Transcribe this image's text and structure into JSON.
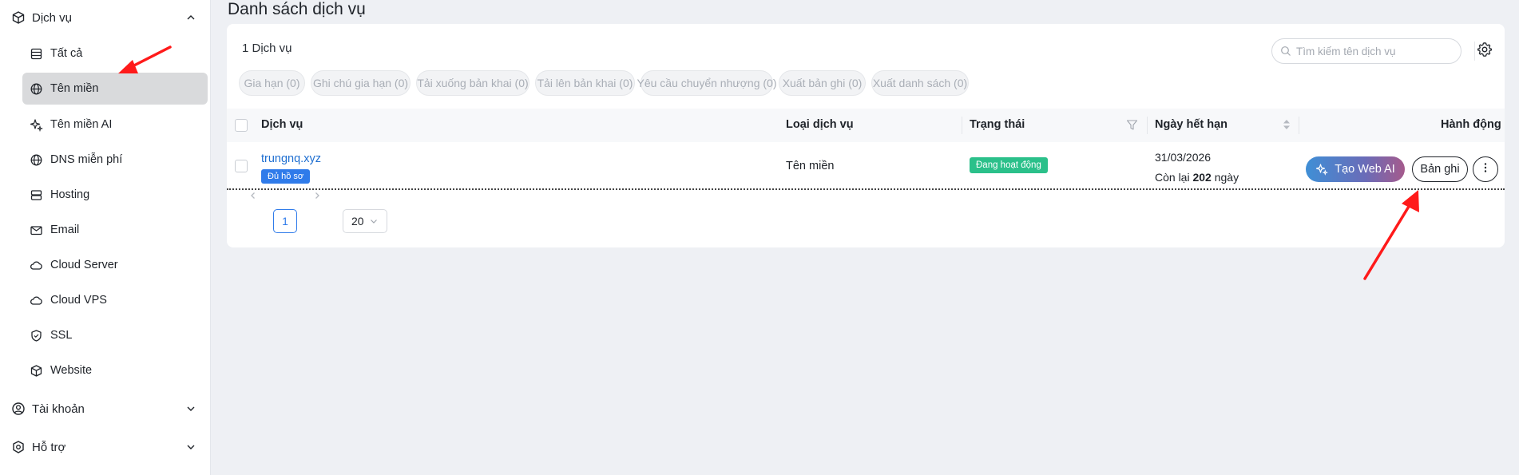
{
  "sidebar": {
    "services_label": "Dịch vụ",
    "items": [
      {
        "label": "Tất cả",
        "icon": "list-icon"
      },
      {
        "label": "Tên miền",
        "icon": "globe-icon"
      },
      {
        "label": "Tên miền AI",
        "icon": "sparkle-icon"
      },
      {
        "label": "DNS miễn phí",
        "icon": "globe-icon"
      },
      {
        "label": "Hosting",
        "icon": "server-icon"
      },
      {
        "label": "Email",
        "icon": "mail-icon"
      },
      {
        "label": "Cloud Server",
        "icon": "cloud-icon"
      },
      {
        "label": "Cloud VPS",
        "icon": "cloud-icon"
      },
      {
        "label": "SSL",
        "icon": "shield-icon"
      },
      {
        "label": "Website",
        "icon": "cube-icon"
      }
    ],
    "account_label": "Tài khoản",
    "support_label": "Hỗ trợ"
  },
  "page": {
    "title": "Danh sách dịch vụ",
    "count": "1 Dịch vụ",
    "search_placeholder": "Tìm kiếm tên dịch vụ"
  },
  "bulk_actions": [
    "Gia hạn (0)",
    "Ghi chú gia hạn (0)",
    "Tải xuống bản khai (0)",
    "Tải lên bản khai (0)",
    "Yêu cầu chuyển nhượng (0)",
    "Xuất bản ghi (0)",
    "Xuất danh sách (0)"
  ],
  "table": {
    "columns": [
      "Dịch vụ",
      "Loại dịch vụ",
      "Trạng thái",
      "Ngày hết hạn",
      "Hành động"
    ],
    "rows": [
      {
        "service": "trungnq.xyz",
        "badge": "Đủ hồ sơ",
        "type": "Tên miền",
        "status": "Đang hoạt động",
        "expiry_date": "31/03/2026",
        "remain_prefix": "Còn lại",
        "remain_days": "202",
        "remain_suffix": "ngày",
        "action_webai": "Tạo Web AI",
        "action_records": "Bản ghi"
      }
    ]
  },
  "pagination": {
    "current_page": "1",
    "page_size": "20"
  },
  "colors": {
    "accent": "#2f7bea",
    "status_active": "#2bc08a",
    "annotation_arrow": "#ff1a1a"
  }
}
